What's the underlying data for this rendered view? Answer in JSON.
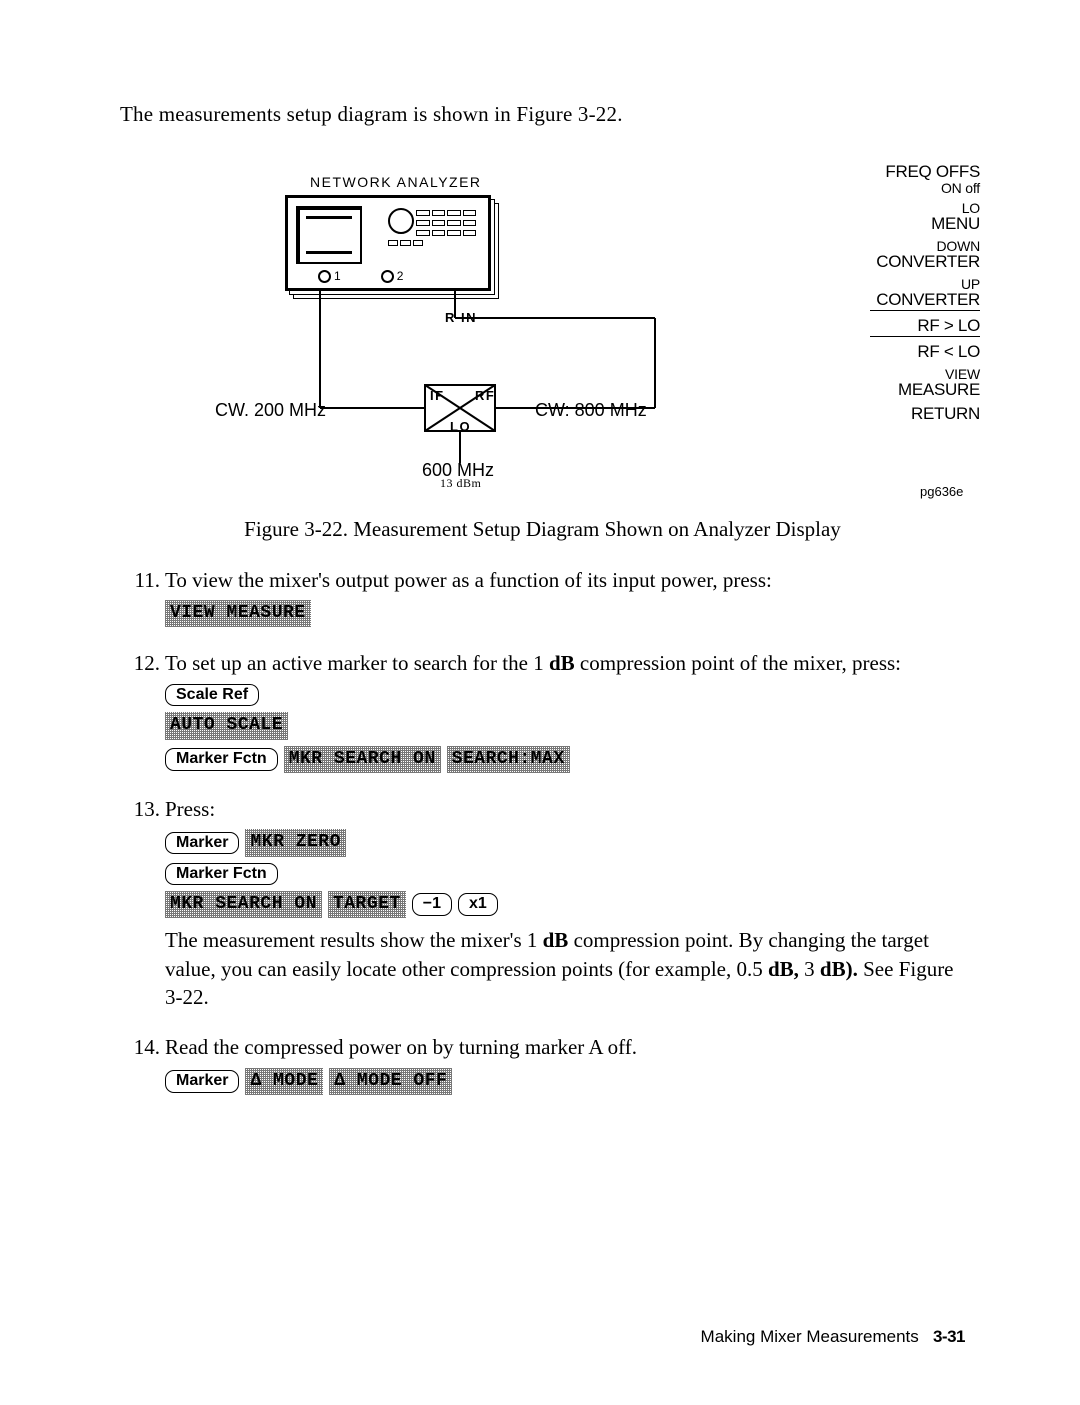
{
  "intro": "The measurements setup diagram is shown in Figure 3-22.",
  "figure": {
    "na_label": "NETWORK  ANALYZER",
    "port1": "1",
    "port2": "2",
    "r_in": "R   IN",
    "if_label": "IF",
    "rf_label": "RF",
    "lo_label": "LO",
    "cw_left": "CW. 200 MHz",
    "cw_right": "CW: 800 MHz",
    "lo_freq": "600 MHz",
    "lo_pwr": "13 dBm",
    "code": "pg636e",
    "softkeys": {
      "freq_offs_a": "FREQ OFFS",
      "freq_offs_b": "ON off",
      "lo_a": "LO",
      "lo_b": "MENU",
      "down_a": "DOWN",
      "down_b": "CONVERTER",
      "up_a": "UP",
      "up_b": "CONVERTER",
      "rfgt": "RF > LO",
      "rflt": "RF < LO",
      "view_a": "VIEW",
      "view_b": "MEASURE",
      "return": "RETURN"
    },
    "caption": "Figure 3-22. Measurement Setup Diagram Shown on Analyzer Display"
  },
  "steps": {
    "s11": {
      "num": "11.",
      "text": "To view the mixer's output power as a function of its input power, press:",
      "k1": "VIEW MEASURE"
    },
    "s12": {
      "num": "12.",
      "text_a": "To set up an active marker to search for the 1 ",
      "text_b": "dB",
      "text_c": " compression point of the mixer, press:",
      "k_scale_ref": "Scale Ref",
      "k_auto_scale": "AUTO SCALE",
      "k_marker_fctn": "Marker Fctn",
      "k_mkr_search_on": "MKR SEARCH ON",
      "k_search_max": "SEARCH:MAX"
    },
    "s13": {
      "num": "13.",
      "text": "Press:",
      "k_marker": "Marker",
      "k_mkr_zero": "MKR ZERO",
      "k_marker_fctn": "Marker Fctn",
      "k_mkr_search_on": "MKR SEARCH ON",
      "k_target": "TARGET",
      "k_minus1": "−1",
      "k_x1": "x1",
      "result_a": "The measurement results show the mixer's 1 ",
      "result_db": "dB",
      "result_b": " compression point. By changing the target value, you can easily locate other compression points (for example, 0.5 ",
      "result_db2": "dB,",
      "result_c": " 3 ",
      "result_db3": "dB).",
      "result_d": " See Figure 3-22."
    },
    "s14": {
      "num": "14.",
      "text": "Read the compressed power on by turning marker A off.",
      "k_marker": "Marker",
      "k_dmode": "Δ MODE",
      "k_dmode_off": "Δ MODE OFF"
    }
  },
  "footer": {
    "title": "Making Mixer Measurements",
    "page": "3-31"
  }
}
